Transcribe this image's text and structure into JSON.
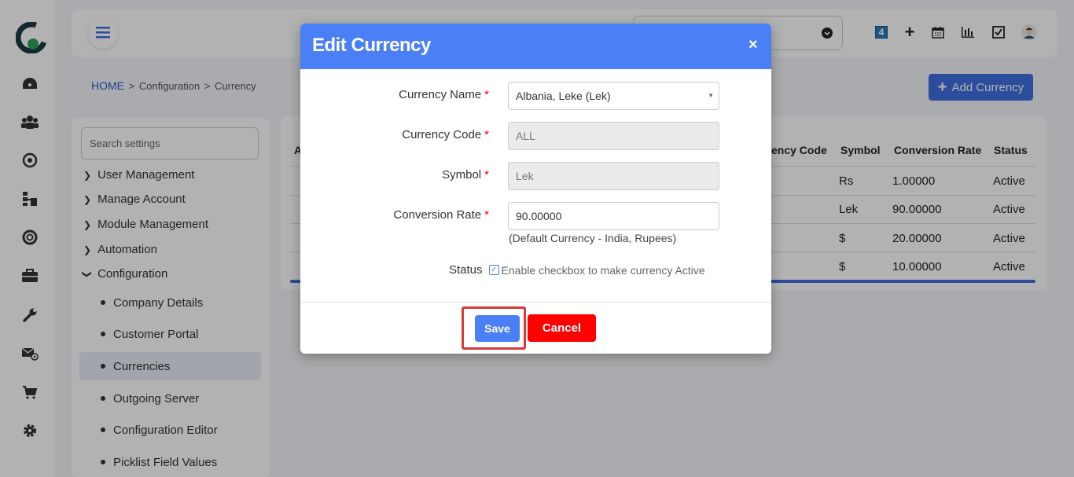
{
  "breadcrumb": {
    "home": "HOME",
    "sep": ">",
    "configuration": "Configuration",
    "currency": "Currency"
  },
  "header": {
    "notification_count": "4"
  },
  "add_currency_label": "Add Currency",
  "settings": {
    "search_placeholder": "Search settings",
    "menu": [
      "User Management",
      "Manage Account",
      "Module Management",
      "Automation",
      "Configuration"
    ],
    "submenu": [
      "Company Details",
      "Customer Portal",
      "Currencies",
      "Outgoing Server",
      "Configuration Editor",
      "Picklist Field Values"
    ],
    "active_submenu": "Currencies"
  },
  "table": {
    "headers": [
      "ency Code",
      "Symbol",
      "Conversion Rate",
      "Status"
    ],
    "rows": [
      {
        "symbol": "Rs",
        "rate": "1.00000",
        "status": "Active"
      },
      {
        "symbol": "Lek",
        "rate": "90.00000",
        "status": "Active"
      },
      {
        "symbol": "$",
        "rate": "20.00000",
        "status": "Active"
      },
      {
        "symbol": "$",
        "rate": "10.00000",
        "status": "Active"
      }
    ],
    "first_header_fragment": "A"
  },
  "modal": {
    "title": "Edit Currency",
    "close": "×",
    "currency_name_label": "Currency Name",
    "currency_name_value": "Albania, Leke (Lek)",
    "currency_code_label": "Currency Code",
    "currency_code_value": "ALL",
    "symbol_label": "Symbol",
    "symbol_value": "Lek",
    "conversion_rate_label": "Conversion Rate",
    "conversion_rate_value": "90.00000",
    "default_currency_note": "(Default Currency - India, Rupees)",
    "status_label": "Status",
    "status_checkbox_text": "Enable checkbox to make currency Active",
    "required_mark": "*",
    "save_label": "Save",
    "cancel_label": "Cancel"
  },
  "colors": {
    "primary": "#4a7ff5",
    "cancel": "#ff0000",
    "highlight": "#d83a3a",
    "logo_green": "#2ea05a",
    "logo_dark": "#1e3a44"
  }
}
